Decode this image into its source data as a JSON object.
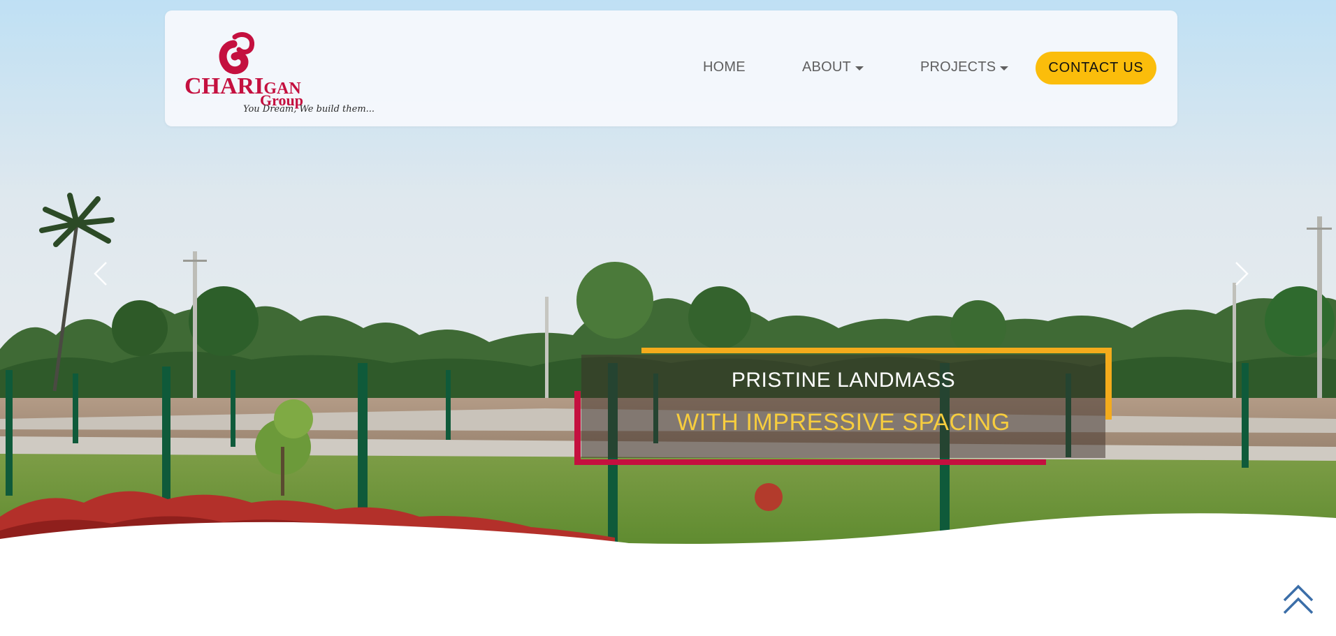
{
  "brand": {
    "name_part1": "CHARI",
    "name_part2": "GAN",
    "group": "Group",
    "tagline": "You Dream, We build them..."
  },
  "nav": {
    "home": "HOME",
    "about": "ABOUT",
    "projects": "PROJECTS",
    "contact": "CONTACT US"
  },
  "hero": {
    "line1": "PRISTINE LANDMASS",
    "line2": "WITH IMPRESSIVE SPACING"
  },
  "icons": {
    "prev": "chevron-left-icon",
    "next": "chevron-right-icon",
    "scroll_top": "double-chevron-up-icon"
  },
  "colors": {
    "brand_red": "#c4103f",
    "accent_yellow": "#fbbd0b",
    "frame_orange": "#f4ab1c",
    "caption_yellow": "#f7cd3e",
    "scroll_icon_blue": "#3b6ea8"
  }
}
